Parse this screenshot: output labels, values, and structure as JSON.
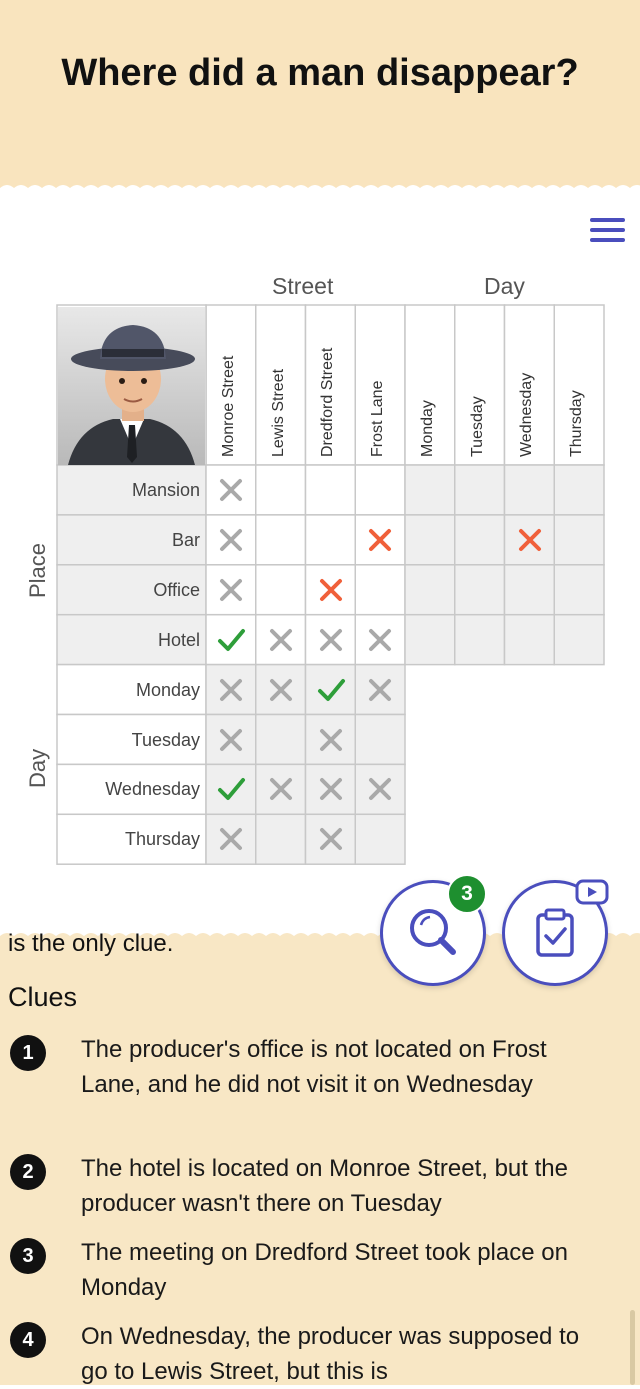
{
  "header": {
    "title": "Where did a man disappear?"
  },
  "grid": {
    "group_headers": {
      "street": "Street",
      "day": "Day"
    },
    "side_headers": {
      "place": "Place",
      "day": "Day"
    },
    "columns": [
      "Monroe Street",
      "Lewis Street",
      "Dredford Street",
      "Frost Lane",
      "Monday",
      "Tuesday",
      "Wednesday",
      "Thursday"
    ],
    "rows": [
      "Mansion",
      "Bar",
      "Office",
      "Hotel",
      "Monday",
      "Tuesday",
      "Wednesday",
      "Thursday"
    ],
    "marks": [
      [
        "x",
        "",
        "",
        "",
        "",
        "",
        "",
        ""
      ],
      [
        "x",
        "",
        "",
        "X",
        "",
        "",
        "X",
        ""
      ],
      [
        "x",
        "",
        "X",
        "",
        "",
        "",
        "",
        ""
      ],
      [
        "v",
        "x",
        "x",
        "x",
        "",
        "",
        "",
        ""
      ],
      [
        "x",
        "x",
        "v",
        "x"
      ],
      [
        "x",
        "",
        "x",
        ""
      ],
      [
        "v",
        "x",
        "x",
        "x"
      ],
      [
        "x",
        "",
        "x",
        ""
      ]
    ]
  },
  "hint_button": {
    "badge": "3",
    "icon": "magnifier-icon"
  },
  "check_button": {
    "icon": "clipboard-check-icon",
    "video_icon": "video-play-icon"
  },
  "clues_section": {
    "partial_text": "is the only clue.",
    "title": "Clues",
    "items": [
      {
        "num": "1",
        "text": "The producer's office is not located on Frost Lane, and he did not visit it on Wednesday"
      },
      {
        "num": "2",
        "text": "The hotel is located on Monroe Street, but the producer wasn't there on Tuesday"
      },
      {
        "num": "3",
        "text": "The meeting on Dredford Street took place on Monday"
      },
      {
        "num": "4",
        "text": "On Wednesday, the producer was supposed to go to Lewis Street, but this is"
      }
    ]
  },
  "colors": {
    "accent": "#4a4ebd",
    "red_x": "#f0603a",
    "gray_x": "#a9a9a9",
    "check": "#2e9e3a",
    "header_bg": "#f9e4be",
    "panel_bg": "#f8e7c5"
  }
}
